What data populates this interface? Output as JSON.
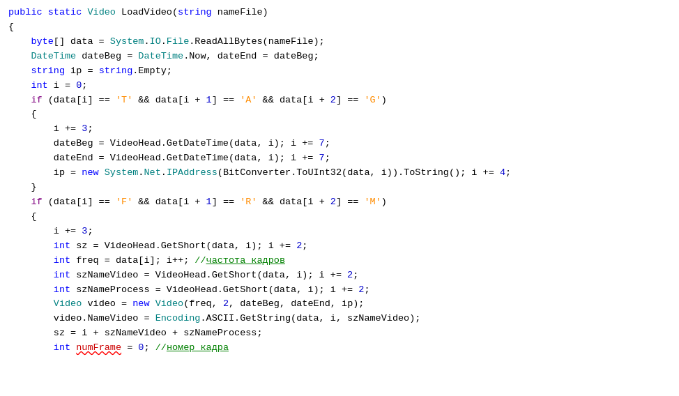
{
  "code": {
    "lines": [
      {
        "id": "line1",
        "tokens": [
          {
            "type": "kw-blue",
            "text": "public"
          },
          {
            "type": "plain",
            "text": " "
          },
          {
            "type": "kw-blue",
            "text": "static"
          },
          {
            "type": "plain",
            "text": " "
          },
          {
            "type": "kw-teal",
            "text": "Video"
          },
          {
            "type": "plain",
            "text": " LoadVideo("
          },
          {
            "type": "kw-blue",
            "text": "string"
          },
          {
            "type": "plain",
            "text": " nameFile)"
          }
        ]
      },
      {
        "id": "line2",
        "tokens": [
          {
            "type": "plain",
            "text": "{"
          }
        ]
      },
      {
        "id": "line3",
        "tokens": [
          {
            "type": "plain",
            "text": "    "
          },
          {
            "type": "kw-blue",
            "text": "byte"
          },
          {
            "type": "plain",
            "text": "[] data = "
          },
          {
            "type": "kw-teal",
            "text": "System"
          },
          {
            "type": "plain",
            "text": "."
          },
          {
            "type": "kw-teal",
            "text": "IO"
          },
          {
            "type": "plain",
            "text": "."
          },
          {
            "type": "kw-teal",
            "text": "File"
          },
          {
            "type": "plain",
            "text": ".ReadAllBytes(nameFile);"
          }
        ]
      },
      {
        "id": "line4",
        "tokens": [
          {
            "type": "plain",
            "text": "    "
          },
          {
            "type": "kw-teal",
            "text": "DateTime"
          },
          {
            "type": "plain",
            "text": " dateBeg = "
          },
          {
            "type": "kw-teal",
            "text": "DateTime"
          },
          {
            "type": "plain",
            "text": ".Now, dateEnd = dateBeg;"
          }
        ]
      },
      {
        "id": "line5",
        "tokens": [
          {
            "type": "plain",
            "text": "    "
          },
          {
            "type": "kw-blue",
            "text": "string"
          },
          {
            "type": "plain",
            "text": " ip = "
          },
          {
            "type": "kw-blue",
            "text": "string"
          },
          {
            "type": "plain",
            "text": ".Empty;"
          }
        ]
      },
      {
        "id": "line6",
        "tokens": [
          {
            "type": "plain",
            "text": "    "
          },
          {
            "type": "kw-blue",
            "text": "int"
          },
          {
            "type": "plain",
            "text": " i = "
          },
          {
            "type": "num-blue",
            "text": "0"
          },
          {
            "type": "plain",
            "text": ";"
          }
        ]
      },
      {
        "id": "line7",
        "tokens": [
          {
            "type": "plain",
            "text": "    "
          },
          {
            "type": "kw-purple",
            "text": "if"
          },
          {
            "type": "plain",
            "text": " (data[i] == "
          },
          {
            "type": "str-orange",
            "text": "'T'"
          },
          {
            "type": "plain",
            "text": " && data[i + "
          },
          {
            "type": "num-blue",
            "text": "1"
          },
          {
            "type": "plain",
            "text": "] == "
          },
          {
            "type": "str-orange",
            "text": "'A'"
          },
          {
            "type": "plain",
            "text": " && data[i + "
          },
          {
            "type": "num-blue",
            "text": "2"
          },
          {
            "type": "plain",
            "text": "] == "
          },
          {
            "type": "str-orange",
            "text": "'G'"
          },
          {
            "type": "plain",
            "text": ")"
          }
        ]
      },
      {
        "id": "line8",
        "tokens": [
          {
            "type": "plain",
            "text": "    {"
          }
        ]
      },
      {
        "id": "line9",
        "tokens": [
          {
            "type": "plain",
            "text": "        i += "
          },
          {
            "type": "num-blue",
            "text": "3"
          },
          {
            "type": "plain",
            "text": ";"
          }
        ]
      },
      {
        "id": "line10",
        "tokens": [
          {
            "type": "plain",
            "text": "        dateBeg = VideoHead.GetDateTime(data, i); i += "
          },
          {
            "type": "num-blue",
            "text": "7"
          },
          {
            "type": "plain",
            "text": ";"
          }
        ]
      },
      {
        "id": "line11",
        "tokens": [
          {
            "type": "plain",
            "text": "        dateEnd = VideoHead.GetDateTime(data, i); i += "
          },
          {
            "type": "num-blue",
            "text": "7"
          },
          {
            "type": "plain",
            "text": ";"
          }
        ]
      },
      {
        "id": "line12",
        "tokens": [
          {
            "type": "plain",
            "text": "        ip = "
          },
          {
            "type": "kw-blue",
            "text": "new"
          },
          {
            "type": "plain",
            "text": " "
          },
          {
            "type": "kw-teal",
            "text": "System"
          },
          {
            "type": "plain",
            "text": "."
          },
          {
            "type": "kw-teal",
            "text": "Net"
          },
          {
            "type": "plain",
            "text": "."
          },
          {
            "type": "kw-teal",
            "text": "IPAddress"
          },
          {
            "type": "plain",
            "text": "(BitConverter.ToUInt32(data, i)).ToString(); i += "
          },
          {
            "type": "num-blue",
            "text": "4"
          },
          {
            "type": "plain",
            "text": ";"
          }
        ]
      },
      {
        "id": "line13",
        "tokens": [
          {
            "type": "plain",
            "text": "    }"
          }
        ]
      },
      {
        "id": "line14",
        "tokens": [
          {
            "type": "plain",
            "text": "    "
          },
          {
            "type": "kw-purple",
            "text": "if"
          },
          {
            "type": "plain",
            "text": " (data[i] == "
          },
          {
            "type": "str-orange",
            "text": "'F'"
          },
          {
            "type": "plain",
            "text": " && data[i + "
          },
          {
            "type": "num-blue",
            "text": "1"
          },
          {
            "type": "plain",
            "text": "] == "
          },
          {
            "type": "str-orange",
            "text": "'R'"
          },
          {
            "type": "plain",
            "text": " && data[i + "
          },
          {
            "type": "num-blue",
            "text": "2"
          },
          {
            "type": "plain",
            "text": "] == "
          },
          {
            "type": "str-orange",
            "text": "'M'"
          },
          {
            "type": "plain",
            "text": ")"
          }
        ]
      },
      {
        "id": "line15",
        "tokens": [
          {
            "type": "plain",
            "text": "    {"
          }
        ]
      },
      {
        "id": "line16",
        "tokens": [
          {
            "type": "plain",
            "text": "        i += "
          },
          {
            "type": "num-blue",
            "text": "3"
          },
          {
            "type": "plain",
            "text": ";"
          }
        ]
      },
      {
        "id": "line17",
        "tokens": [
          {
            "type": "plain",
            "text": "        "
          },
          {
            "type": "kw-blue",
            "text": "int"
          },
          {
            "type": "plain",
            "text": " sz = VideoHead.GetShort(data, i); i += "
          },
          {
            "type": "num-blue",
            "text": "2"
          },
          {
            "type": "plain",
            "text": ";"
          }
        ]
      },
      {
        "id": "line18",
        "tokens": [
          {
            "type": "plain",
            "text": "        "
          },
          {
            "type": "kw-blue",
            "text": "int"
          },
          {
            "type": "plain",
            "text": " freq = data[i]; i++; "
          },
          {
            "type": "comment",
            "text": "//"
          },
          {
            "type": "comment-underline",
            "text": "частота кадров"
          }
        ]
      },
      {
        "id": "line19",
        "tokens": [
          {
            "type": "plain",
            "text": "        "
          },
          {
            "type": "kw-blue",
            "text": "int"
          },
          {
            "type": "plain",
            "text": " szNameVideo = VideoHead.GetShort(data, i); i += "
          },
          {
            "type": "num-blue",
            "text": "2"
          },
          {
            "type": "plain",
            "text": ";"
          }
        ]
      },
      {
        "id": "line20",
        "tokens": [
          {
            "type": "plain",
            "text": "        "
          },
          {
            "type": "kw-blue",
            "text": "int"
          },
          {
            "type": "plain",
            "text": " szNameProcess = VideoHead.GetShort(data, i); i += "
          },
          {
            "type": "num-blue",
            "text": "2"
          },
          {
            "type": "plain",
            "text": ";"
          }
        ]
      },
      {
        "id": "line21",
        "tokens": [
          {
            "type": "plain",
            "text": "        "
          },
          {
            "type": "kw-teal",
            "text": "Video"
          },
          {
            "type": "plain",
            "text": " video = "
          },
          {
            "type": "kw-blue",
            "text": "new"
          },
          {
            "type": "plain",
            "text": " "
          },
          {
            "type": "kw-teal",
            "text": "Video"
          },
          {
            "type": "plain",
            "text": "(freq, "
          },
          {
            "type": "num-blue",
            "text": "2"
          },
          {
            "type": "plain",
            "text": ", dateBeg, dateEnd, ip);"
          }
        ]
      },
      {
        "id": "line22",
        "tokens": [
          {
            "type": "plain",
            "text": "        video.NameVideo = "
          },
          {
            "type": "kw-teal",
            "text": "Encoding"
          },
          {
            "type": "plain",
            "text": ".ASCII.GetString(data, i, szNameVideo);"
          }
        ]
      },
      {
        "id": "line23",
        "tokens": [
          {
            "type": "plain",
            "text": "        sz = i + szNameVideo + szNameProcess;"
          }
        ]
      },
      {
        "id": "line24",
        "tokens": [
          {
            "type": "plain",
            "text": "        "
          },
          {
            "type": "kw-blue",
            "text": "int"
          },
          {
            "type": "plain",
            "text": " "
          },
          {
            "type": "red-underline",
            "text": "numFrame"
          },
          {
            "type": "plain",
            "text": " = "
          },
          {
            "type": "num-blue",
            "text": "0"
          },
          {
            "type": "plain",
            "text": "; "
          },
          {
            "type": "comment",
            "text": "//"
          },
          {
            "type": "comment-underline",
            "text": "номер кадра"
          }
        ]
      }
    ]
  }
}
